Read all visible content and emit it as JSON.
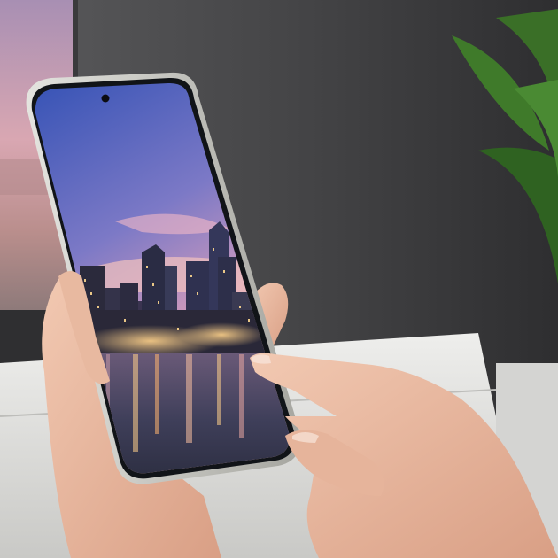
{
  "scene": {
    "subject": "hands-holding-smartphone",
    "wallpaper": "city-skyline-at-dusk-reflected-in-water",
    "colors": {
      "room_wall": "#4a4a4c",
      "window_pink": "#c89aa6",
      "sofa_white": "#e6e6e4",
      "plant_green": "#3f7a2a",
      "phone_frame": "#c9c9c4",
      "sky_top": "#3e57b7",
      "sky_horizon": "#e7a3b7",
      "water": "#3b3d56",
      "skin": "#e8b9a0"
    }
  }
}
